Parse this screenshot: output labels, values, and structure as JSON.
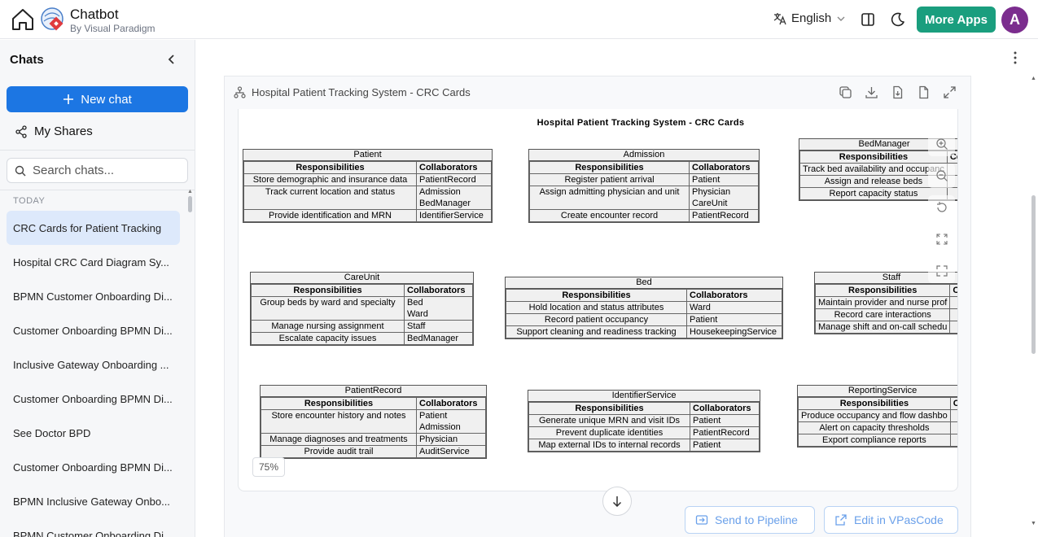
{
  "header": {
    "app_title": "Chatbot",
    "app_subtitle": "By Visual Paradigm",
    "language": "English",
    "more_apps_label": "More Apps",
    "avatar_initial": "A",
    "accent_color": "#1a9e7e",
    "avatar_color": "#7b2d8e"
  },
  "sidebar": {
    "title": "Chats",
    "new_chat_label": "New chat",
    "my_shares_label": "My Shares",
    "search_placeholder": "Search chats...",
    "section_label": "TODAY",
    "chats": [
      {
        "label": "CRC Cards for Patient Tracking",
        "active": true
      },
      {
        "label": "Hospital CRC Card Diagram Sy...",
        "active": false
      },
      {
        "label": "BPMN Customer Onboarding Di...",
        "active": false
      },
      {
        "label": "Customer Onboarding BPMN Di...",
        "active": false
      },
      {
        "label": "Inclusive Gateway Onboarding ...",
        "active": false
      },
      {
        "label": "Customer Onboarding BPMN Di...",
        "active": false
      },
      {
        "label": "See Doctor BPD",
        "active": false
      },
      {
        "label": "Customer Onboarding BPMN Di...",
        "active": false
      },
      {
        "label": "BPMN Inclusive Gateway Onbo...",
        "active": false
      },
      {
        "label": "BPMN Customer Onboarding Di...",
        "active": false
      }
    ],
    "primary_color": "#1c76e3"
  },
  "diagram_panel": {
    "title": "Hospital Patient Tracking System - CRC Cards",
    "zoom_level": "75%",
    "send_to_pipeline_label": "Send to Pipeline",
    "edit_label": "Edit in VPasCode"
  },
  "diagram": {
    "title": "Hospital Patient Tracking System - CRC Cards",
    "resp_header": "Responsibilities",
    "collab_header": "Collaborators",
    "cards": [
      {
        "name": "Patient",
        "rows": [
          {
            "r": "Store demographic and insurance data",
            "c": [
              "PatientRecord"
            ]
          },
          {
            "r": "Track current location and status",
            "c": [
              "Admission",
              "BedManager"
            ]
          },
          {
            "r": "Provide identification and MRN",
            "c": [
              "IdentifierService"
            ]
          }
        ]
      },
      {
        "name": "Admission",
        "rows": [
          {
            "r": "Register patient arrival",
            "c": [
              "Patient"
            ]
          },
          {
            "r": "Assign admitting physician and unit",
            "c": [
              "Physician",
              "CareUnit"
            ]
          },
          {
            "r": "Create encounter record",
            "c": [
              "PatientRecord"
            ]
          }
        ]
      },
      {
        "name": "BedManager",
        "rows": [
          {
            "r": "Track bed availability and occupanc",
            "c": [
              ""
            ]
          },
          {
            "r": "Assign and release beds",
            "c": [
              ""
            ]
          },
          {
            "r": "Report capacity status",
            "c": [
              ""
            ]
          }
        ]
      },
      {
        "name": "CareUnit",
        "rows": [
          {
            "r": "Group beds by ward and specialty",
            "c": [
              "Bed",
              "Ward"
            ]
          },
          {
            "r": "Manage nursing assignment",
            "c": [
              "Staff"
            ]
          },
          {
            "r": "Escalate capacity issues",
            "c": [
              "BedManager"
            ]
          }
        ]
      },
      {
        "name": "Bed",
        "rows": [
          {
            "r": "Hold location and status attributes",
            "c": [
              "Ward"
            ]
          },
          {
            "r": "Record patient occupancy",
            "c": [
              "Patient"
            ]
          },
          {
            "r": "Support cleaning and readiness tracking",
            "c": [
              "HousekeepingService"
            ]
          }
        ]
      },
      {
        "name": "Staff",
        "rows": [
          {
            "r": "Maintain provider and nurse prof",
            "c": [
              ""
            ]
          },
          {
            "r": "Record care interactions",
            "c": [
              ""
            ]
          },
          {
            "r": "Manage shift and on-call schedu",
            "c": [
              ""
            ]
          }
        ]
      },
      {
        "name": "PatientRecord",
        "rows": [
          {
            "r": "Store encounter history and notes",
            "c": [
              "Patient",
              "Admission"
            ]
          },
          {
            "r": "Manage diagnoses and treatments",
            "c": [
              "Physician"
            ]
          },
          {
            "r": "Provide audit trail",
            "c": [
              "AuditService"
            ]
          }
        ]
      },
      {
        "name": "IdentifierService",
        "rows": [
          {
            "r": "Generate unique MRN and visit IDs",
            "c": [
              "Patient"
            ]
          },
          {
            "r": "Prevent duplicate identities",
            "c": [
              "PatientRecord"
            ]
          },
          {
            "r": "Map external IDs to internal records",
            "c": [
              "Patient"
            ]
          }
        ]
      },
      {
        "name": "ReportingService",
        "rows": [
          {
            "r": "Produce occupancy and flow dashbo",
            "c": [
              ""
            ]
          },
          {
            "r": "Alert on capacity thresholds",
            "c": [
              ""
            ]
          },
          {
            "r": "Export compliance reports",
            "c": [
              ""
            ]
          }
        ]
      }
    ]
  }
}
